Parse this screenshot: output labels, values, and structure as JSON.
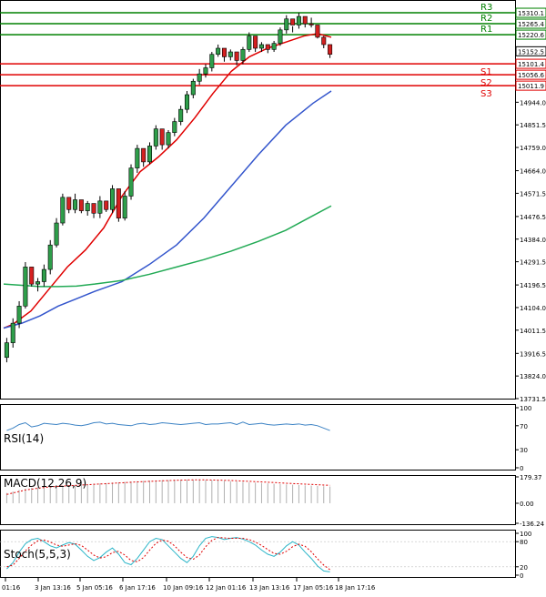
{
  "chart_data": [
    {
      "type": "candlestick",
      "panel": "price",
      "y_ticks": [
        "15310.1",
        "15265.4",
        "15220.6",
        "15152.5",
        "15101.4",
        "15056.6",
        "15011.9",
        "14944.0",
        "14851.5",
        "14759.0",
        "14664.0",
        "14571.5",
        "14476.5",
        "14384.0",
        "14291.5",
        "14196.5",
        "14104.0",
        "14011.5",
        "13916.5",
        "13824.0",
        "13731.5"
      ],
      "ylim": [
        13731.5,
        15340
      ],
      "current_price": "15152.5",
      "levels": [
        {
          "name": "R3",
          "value": 15310.1,
          "label": "15310.1",
          "color": "#008000"
        },
        {
          "name": "R2",
          "value": 15265.4,
          "label": "15265.4",
          "color": "#008000"
        },
        {
          "name": "R1",
          "value": 15220.6,
          "label": "15220.6",
          "color": "#008000"
        },
        {
          "name": "S1",
          "value": 15101.4,
          "label": "15101.4",
          "color": "#e00000"
        },
        {
          "name": "S2",
          "value": 15056.6,
          "label": "15056.6",
          "color": "#e00000"
        },
        {
          "name": "S3",
          "value": 15011.9,
          "label": "15011.9",
          "color": "#e00000"
        }
      ],
      "candles": [
        [
          13900,
          13980,
          13880,
          13960
        ],
        [
          13960,
          14060,
          13940,
          14040
        ],
        [
          14040,
          14130,
          14020,
          14110
        ],
        [
          14110,
          14290,
          14100,
          14270
        ],
        [
          14270,
          14230,
          14190,
          14200
        ],
        [
          14200,
          14225,
          14170,
          14210
        ],
        [
          14210,
          14280,
          14190,
          14260
        ],
        [
          14260,
          14380,
          14240,
          14360
        ],
        [
          14360,
          14470,
          14350,
          14450
        ],
        [
          14450,
          14570,
          14440,
          14555
        ],
        [
          14555,
          14530,
          14490,
          14505
        ],
        [
          14505,
          14570,
          14490,
          14545
        ],
        [
          14545,
          14520,
          14490,
          14500
        ],
        [
          14500,
          14540,
          14480,
          14530
        ],
        [
          14530,
          14510,
          14470,
          14490
        ],
        [
          14490,
          14560,
          14470,
          14540
        ],
        [
          14540,
          14515,
          14495,
          14505
        ],
        [
          14505,
          14605,
          14490,
          14590
        ],
        [
          14590,
          14470,
          14455,
          14470
        ],
        [
          14470,
          14580,
          14460,
          14560
        ],
        [
          14560,
          14690,
          14545,
          14675
        ],
        [
          14675,
          14770,
          14655,
          14755
        ],
        [
          14755,
          14710,
          14680,
          14700
        ],
        [
          14700,
          14780,
          14690,
          14765
        ],
        [
          14765,
          14850,
          14750,
          14835
        ],
        [
          14835,
          14790,
          14750,
          14770
        ],
        [
          14770,
          14830,
          14755,
          14820
        ],
        [
          14820,
          14880,
          14805,
          14865
        ],
        [
          14865,
          14930,
          14850,
          14915
        ],
        [
          14915,
          14990,
          14900,
          14975
        ],
        [
          14975,
          15040,
          14960,
          15030
        ],
        [
          15030,
          15080,
          15015,
          15060
        ],
        [
          15060,
          15100,
          15045,
          15085
        ],
        [
          15085,
          15150,
          15070,
          15140
        ],
        [
          15140,
          15180,
          15130,
          15165
        ],
        [
          15165,
          15140,
          15110,
          15130
        ],
        [
          15130,
          15160,
          15115,
          15150
        ],
        [
          15150,
          15120,
          15095,
          15115
        ],
        [
          15115,
          15170,
          15100,
          15160
        ],
        [
          15160,
          15230,
          15150,
          15215
        ],
        [
          15215,
          15170,
          15150,
          15165
        ],
        [
          15165,
          15190,
          15150,
          15180
        ],
        [
          15180,
          15165,
          15145,
          15160
        ],
        [
          15160,
          15195,
          15150,
          15185
        ],
        [
          15185,
          15250,
          15175,
          15240
        ],
        [
          15240,
          15300,
          15225,
          15285
        ],
        [
          15285,
          15255,
          15230,
          15260
        ],
        [
          15260,
          15310,
          15245,
          15295
        ],
        [
          15295,
          15270,
          15250,
          15265
        ],
        [
          15265,
          15290,
          15250,
          15260
        ],
        [
          15260,
          15225,
          15205,
          15210
        ],
        [
          15210,
          15215,
          15165,
          15180
        ],
        [
          15180,
          15170,
          15125,
          15140
        ]
      ],
      "ma_series": [
        {
          "color": "#e00000",
          "points": [
            [
              0,
              14020
            ],
            [
              10,
              14035
            ],
            [
              30,
              14090
            ],
            [
              50,
              14180
            ],
            [
              70,
              14270
            ],
            [
              90,
              14340
            ],
            [
              110,
              14430
            ],
            [
              130,
              14560
            ],
            [
              150,
              14660
            ],
            [
              170,
              14720
            ],
            [
              190,
              14790
            ],
            [
              210,
              14880
            ],
            [
              230,
              14980
            ],
            [
              250,
              15070
            ],
            [
              270,
              15130
            ],
            [
              290,
              15165
            ],
            [
              310,
              15190
            ],
            [
              330,
              15215
            ],
            [
              345,
              15225
            ],
            [
              360,
              15210
            ]
          ]
        },
        {
          "color": "#3355cc",
          "points": [
            [
              0,
              14020
            ],
            [
              20,
              14040
            ],
            [
              40,
              14070
            ],
            [
              60,
              14110
            ],
            [
              80,
              14140
            ],
            [
              100,
              14170
            ],
            [
              130,
              14210
            ],
            [
              160,
              14280
            ],
            [
              190,
              14360
            ],
            [
              220,
              14470
            ],
            [
              250,
              14600
            ],
            [
              280,
              14730
            ],
            [
              310,
              14850
            ],
            [
              340,
              14940
            ],
            [
              360,
              14990
            ]
          ]
        },
        {
          "color": "#22aa55",
          "points": [
            [
              0,
              14200
            ],
            [
              20,
              14195
            ],
            [
              40,
              14190
            ],
            [
              60,
              14190
            ],
            [
              80,
              14192
            ],
            [
              100,
              14200
            ],
            [
              130,
              14215
            ],
            [
              160,
              14240
            ],
            [
              190,
              14270
            ],
            [
              220,
              14300
            ],
            [
              250,
              14335
            ],
            [
              280,
              14375
            ],
            [
              310,
              14420
            ],
            [
              340,
              14480
            ],
            [
              360,
              14520
            ]
          ]
        }
      ],
      "x_ticks": [
        "01:16",
        "3 Jan 13:16",
        "5 Jan 05:16",
        "6 Jan 17:16",
        "10 Jan 09:16",
        "12 Jan 01:16",
        "13 Jan 13:16",
        "17 Jan 05:16",
        "18 Jan 17:16"
      ]
    },
    {
      "type": "line",
      "panel": "rsi",
      "label": "RSI(14)",
      "y_ticks": [
        "100",
        "70",
        "30",
        "0"
      ],
      "ylim": [
        0,
        100
      ],
      "color": "#3b82c4",
      "values": [
        62,
        66,
        72,
        75,
        68,
        70,
        74,
        73,
        72,
        74,
        73,
        71,
        70,
        72,
        75,
        76,
        73,
        74,
        72,
        71,
        70,
        73,
        74,
        72,
        73,
        75,
        74,
        73,
        72,
        73,
        74,
        75,
        72,
        73,
        73,
        74,
        75,
        72,
        76,
        72,
        73,
        74,
        72,
        71,
        72,
        73,
        72,
        73,
        71,
        72,
        70,
        66,
        62
      ]
    },
    {
      "type": "bar",
      "panel": "macd",
      "label": "MACD(12,26,9)",
      "y_ticks": [
        "179.37",
        "0.00",
        "-136.24"
      ],
      "ylim": [
        -136.24,
        179.37
      ],
      "bar_color": "#b0b0b0",
      "signal_color": "#e00000",
      "values": [
        70,
        80,
        90,
        100,
        105,
        110,
        112,
        115,
        118,
        120,
        122,
        125,
        127,
        130,
        132,
        135,
        137,
        140,
        142,
        145,
        147,
        150,
        152,
        154,
        155,
        157,
        158,
        160,
        160,
        160,
        160,
        159,
        158,
        157,
        155,
        153,
        150,
        148,
        145,
        142,
        140,
        137,
        135,
        132,
        130,
        128,
        126,
        124,
        122,
        120,
        118,
        116,
        114
      ],
      "signal": [
        60,
        70,
        80,
        90,
        96,
        102,
        107,
        111,
        114,
        117,
        119,
        121,
        124,
        126,
        129,
        131,
        133,
        136,
        138,
        140,
        143,
        145,
        147,
        149,
        151,
        153,
        154,
        156,
        157,
        158,
        159,
        159,
        159,
        158,
        157,
        156,
        155,
        153,
        151,
        149,
        147,
        145,
        143,
        141,
        138,
        136,
        134,
        132,
        130,
        128,
        126,
        124,
        122
      ]
    },
    {
      "type": "line",
      "panel": "stoch",
      "label": "Stoch(5,5,3)",
      "y_ticks": [
        "100",
        "80",
        "20",
        "0"
      ],
      "ylim": [
        0,
        100
      ],
      "k_color": "#2bb5c8",
      "d_color": "#e00000",
      "k": [
        15,
        30,
        55,
        75,
        85,
        88,
        80,
        70,
        65,
        72,
        78,
        74,
        60,
        45,
        35,
        42,
        55,
        65,
        50,
        30,
        25,
        40,
        60,
        80,
        88,
        85,
        70,
        55,
        40,
        30,
        45,
        70,
        88,
        92,
        90,
        85,
        88,
        90,
        86,
        80,
        72,
        60,
        50,
        45,
        55,
        70,
        80,
        72,
        55,
        40,
        22,
        10,
        8
      ],
      "d": [
        20,
        24,
        40,
        58,
        72,
        82,
        84,
        79,
        72,
        69,
        72,
        75,
        71,
        60,
        48,
        41,
        44,
        54,
        57,
        48,
        35,
        32,
        42,
        60,
        76,
        84,
        81,
        70,
        55,
        42,
        38,
        48,
        68,
        83,
        90,
        89,
        88,
        88,
        88,
        85,
        79,
        71,
        61,
        52,
        50,
        57,
        68,
        74,
        69,
        56,
        39,
        24,
        13
      ]
    }
  ]
}
